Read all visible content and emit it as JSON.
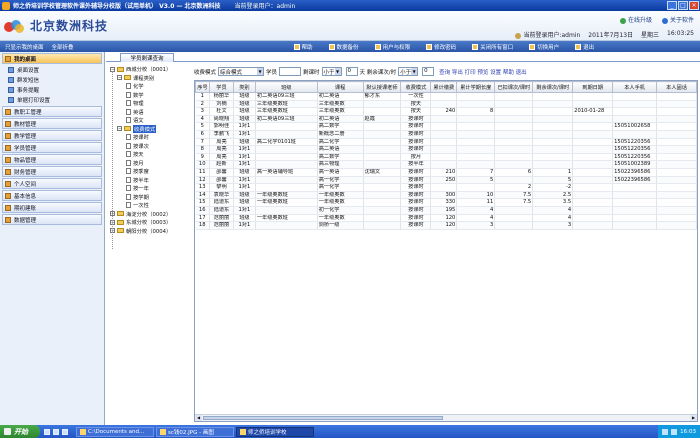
{
  "titlebar": {
    "title": "师之侨培训学校管理软件课外辅导分校版（试用单机） V3.0 — 北京数洲科技",
    "user": "当前登录用户：admin"
  },
  "header": {
    "company": "北京数洲科技",
    "link_upgrade": "在线升级",
    "link_about": "关于软件",
    "login_user": "当前登录用户:admin",
    "date": "2011年7月13日",
    "weekday": "星期三",
    "time": "16:03:25"
  },
  "navbar": {
    "label1": "只显示我的桌面",
    "label2": "全部折叠",
    "buttons": [
      "帮助",
      "数据备份",
      "用户与权限",
      "修改密码",
      "关闭所有窗口",
      "切换用户",
      "退出"
    ]
  },
  "sidebar": {
    "desk": "我的桌面",
    "sub": [
      "桌面设置",
      "群发短信",
      "事务提醒",
      "单据打印设置"
    ],
    "groups": [
      "教职工管理",
      "教材管理",
      "教学管理",
      "学员管理",
      "物品管理",
      "财务管理",
      "个人空间",
      "基本信息",
      "期初建账",
      "数据管理"
    ]
  },
  "tab": {
    "label": "学员剩课查询"
  },
  "tree": {
    "root1": "西城分校（0001）",
    "course_cat": "课程类别",
    "courses": [
      "化学",
      "数学",
      "物理",
      "英语",
      "语文"
    ],
    "fee_mode": "收费模式",
    "modes": [
      "按课时",
      "按课次",
      "按天",
      "按月",
      "按季度",
      "按半年",
      "按一年",
      "按学期",
      "一次性"
    ],
    "root2": "海淀分校（0002）",
    "root3": "东城分校（0003）",
    "root4": "朝阳分校（0004）"
  },
  "filter": {
    "mode_label": "收费模式",
    "mode_value": "综合模式",
    "student_label": "学员",
    "remain_label": "剩课时",
    "op1": "小于",
    "v1": "0",
    "days_label": "天 剩余课次/时",
    "op2": "小于",
    "v2": "0",
    "actions": "查询 导出 打印 预览 设置 帮助 退出"
  },
  "table": {
    "headers": [
      "序号",
      "学员",
      "类别",
      "班级",
      "课程",
      "默认授课老师",
      "收费模式",
      "累计缴费",
      "累计学期长度",
      "已扣课次/课时",
      "剩余课次/课时",
      "到期日期",
      "本人手机",
      "本人固话"
    ],
    "rows": [
      [
        "1",
        "杨丽华",
        "班级",
        "初二英语09三班",
        "初二英语",
        "郁才东",
        "一次性",
        "",
        "",
        "",
        "",
        "",
        "",
        ""
      ],
      [
        "2",
        "刘楠",
        "班级",
        "三年级奥数班",
        "三年级奥数",
        "",
        "按天",
        "",
        "",
        "",
        "",
        "",
        "",
        ""
      ],
      [
        "3",
        "杜文",
        "班级",
        "三年级奥数班",
        "三年级奥数",
        "",
        "按天",
        "240",
        "8",
        "",
        "",
        "2010-01-28",
        "",
        ""
      ],
      [
        "4",
        "尚晓翔",
        "班级",
        "初二英语09三班",
        "初二英语",
        "赵霞",
        "按课时",
        "",
        "",
        "",
        "",
        "",
        "",
        ""
      ],
      [
        "5",
        "郭明佳",
        "1对1",
        "",
        "高二数学",
        "",
        "按课时",
        "",
        "",
        "",
        "",
        "",
        "15051002658",
        ""
      ],
      [
        "6",
        "李鹏飞",
        "1对1",
        "",
        "新概念二册",
        "",
        "按课时",
        "",
        "",
        "",
        "",
        "",
        "",
        ""
      ],
      [
        "7",
        "周亮",
        "班级",
        "高二化学0101班",
        "高二化学",
        "",
        "按课时",
        "",
        "",
        "",
        "",
        "",
        "15051220356",
        ""
      ],
      [
        "8",
        "周亮",
        "1对1",
        "",
        "高二英语",
        "",
        "按课时",
        "",
        "",
        "",
        "",
        "",
        "15051220356",
        ""
      ],
      [
        "9",
        "周亮",
        "1对1",
        "",
        "高二数学",
        "",
        "按月",
        "",
        "",
        "",
        "",
        "",
        "15051220356",
        ""
      ],
      [
        "10",
        "赵新",
        "1对1",
        "",
        "高三物理",
        "",
        "按半年",
        "",
        "",
        "",
        "",
        "",
        "15051002389",
        ""
      ],
      [
        "11",
        "邵馨",
        "班级",
        "高一英语辅导班",
        "高一英语",
        "沈瑞文",
        "按课时",
        "210",
        "7",
        "6",
        "1",
        "",
        "15022396586",
        ""
      ],
      [
        "12",
        "邵馨",
        "1对1",
        "",
        "高一化学",
        "",
        "按课时",
        "250",
        "5",
        "",
        "5",
        "",
        "15022396586",
        ""
      ],
      [
        "13",
        "黎明",
        "1对1",
        "",
        "高一化学",
        "",
        "按课时",
        "",
        "",
        "2",
        "-2",
        "",
        "",
        ""
      ],
      [
        "14",
        "袁晓华",
        "班级",
        "一年级奥数班",
        "一年级奥数",
        "",
        "按课时",
        "300",
        "10",
        "7.5",
        "2.5",
        "",
        "",
        ""
      ],
      [
        "15",
        "陆道东",
        "班级",
        "一年级奥数班",
        "一年级奥数",
        "",
        "按课时",
        "330",
        "11",
        "7.5",
        "3.5",
        "",
        "",
        ""
      ],
      [
        "16",
        "陆道东",
        "1对1",
        "",
        "初一化学",
        "",
        "按课时",
        "195",
        "4",
        "",
        "4",
        "",
        "",
        ""
      ],
      [
        "17",
        "范丽丽",
        "班级",
        "一年级奥数班",
        "一年级奥数",
        "",
        "按课时",
        "120",
        "4",
        "",
        "4",
        "",
        "",
        ""
      ],
      [
        "18",
        "范丽丽",
        "1对1",
        "",
        "剑桥一级",
        "",
        "按课时",
        "120",
        "3",
        "",
        "3",
        "",
        "",
        ""
      ]
    ]
  },
  "taskbar": {
    "start": "开始",
    "tasks": [
      "C:\\Documents and...",
      "sc钱02.JPG - 画图",
      "师之侨培训学校"
    ],
    "clock": "16:03"
  },
  "colors": {
    "accent": "#2a5fc8",
    "nav": "#2a55a6",
    "taskbar": "#2355c4"
  }
}
